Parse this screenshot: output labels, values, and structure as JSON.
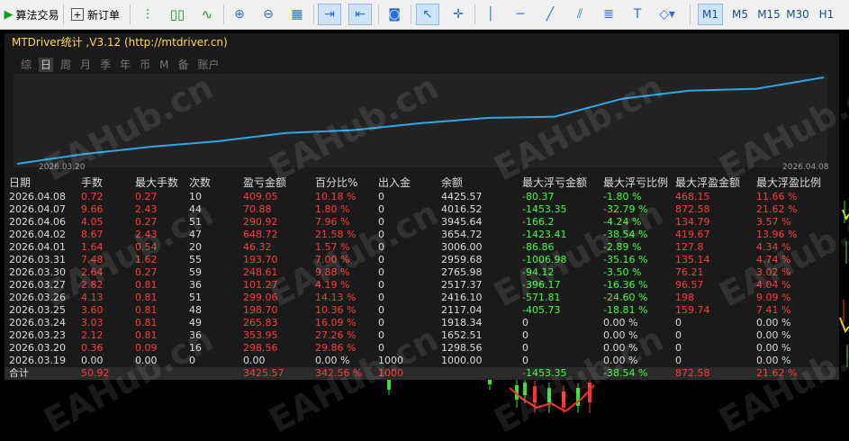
{
  "toolbar": {
    "algo_trading_label": "算法交易",
    "new_order_label": "新订单",
    "timeframes": [
      "M1",
      "M5",
      "M15",
      "M30",
      "H1"
    ],
    "active_timeframe": "M1"
  },
  "panel": {
    "title": "MTDriver统计 ,V3.12 (http://mtdriver.cn)",
    "tabs": [
      "综",
      "日",
      "周",
      "月",
      "季",
      "年",
      "币",
      "M",
      "备",
      "账户"
    ],
    "active_tab": "日",
    "start_date": "2026.03.20",
    "end_date": "2026.04.08"
  },
  "equity_curve": {
    "line_color": "#29a9e8",
    "dates": [
      "2026.03.20",
      "2026.03.23",
      "2026.03.24",
      "2026.03.25",
      "2026.03.26",
      "2026.03.27",
      "2026.03.30",
      "2026.03.31",
      "2026.04.01",
      "2026.04.02",
      "2026.04.06",
      "2026.04.07",
      "2026.04.08"
    ],
    "balance": [
      1298.56,
      1652.51,
      1918.34,
      2117.04,
      2416.1,
      2517.37,
      2765.98,
      2959.68,
      3006.0,
      3654.72,
      3945.64,
      4016.52,
      4425.57
    ]
  },
  "table": {
    "headers": [
      "日期",
      "手数",
      "最大手数",
      "次数",
      "盈亏金额",
      "百分比%",
      "出入金",
      "余额",
      "最大浮亏金额",
      "最大浮亏比例",
      "最大浮盈金额",
      "最大浮盈比例"
    ],
    "rows": [
      [
        "2026.04.08",
        "0.72",
        "0.27",
        "10",
        "409.05",
        "10.18 %",
        "0",
        "4425.57",
        "-80.37",
        "-1.80 %",
        "468.15",
        "11.66 %"
      ],
      [
        "2026.04.07",
        "9.66",
        "2.43",
        "44",
        "70.88",
        "1.80 %",
        "0",
        "4016.52",
        "-1453.35",
        "-32.79 %",
        "872.58",
        "21.62 %"
      ],
      [
        "2026.04.06",
        "4.05",
        "0.27",
        "51",
        "290.92",
        "7.96 %",
        "0",
        "3945.64",
        "-166.2",
        "-4.24 %",
        "134.79",
        "3.57 %"
      ],
      [
        "2026.04.02",
        "8.67",
        "2.43",
        "47",
        "648.72",
        "21.58 %",
        "0",
        "3654.72",
        "-1423.41",
        "-38.54 %",
        "419.67",
        "13.96 %"
      ],
      [
        "2026.04.01",
        "1.64",
        "0.54",
        "20",
        "46.32",
        "1.57 %",
        "0",
        "3006.00",
        "-86.86",
        "-2.89 %",
        "127.8",
        "4.34 %"
      ],
      [
        "2026.03.31",
        "7.48",
        "1.62",
        "55",
        "193.70",
        "7.00 %",
        "0",
        "2959.68",
        "-1006.98",
        "-35.16 %",
        "135.14",
        "4.74 %"
      ],
      [
        "2026.03.30",
        "2.64",
        "0.27",
        "59",
        "248.61",
        "9.88 %",
        "0",
        "2765.98",
        "-94.12",
        "-3.50 %",
        "76.21",
        "3.02 %"
      ],
      [
        "2026.03.27",
        "2.82",
        "0.81",
        "36",
        "101.27",
        "4.19 %",
        "0",
        "2517.37",
        "-396.17",
        "-16.36 %",
        "96.57",
        "4.04 %"
      ],
      [
        "2026.03.26",
        "4.13",
        "0.81",
        "51",
        "299.06",
        "14.13 %",
        "0",
        "2416.10",
        "-571.81",
        "-24.60 %",
        "198",
        "9.09 %"
      ],
      [
        "2026.03.25",
        "3.60",
        "0.81",
        "48",
        "198.70",
        "10.36 %",
        "0",
        "2117.04",
        "-405.73",
        "-18.81 %",
        "159.74",
        "7.41 %"
      ],
      [
        "2026.03.24",
        "3.03",
        "0.81",
        "49",
        "265.83",
        "16.09 %",
        "0",
        "1918.34",
        "0",
        "0.00 %",
        "0",
        "0.00 %"
      ],
      [
        "2026.03.23",
        "2.12",
        "0.81",
        "36",
        "353.95",
        "27.26 %",
        "0",
        "1652.51",
        "0",
        "0.00 %",
        "0",
        "0.00 %"
      ],
      [
        "2026.03.20",
        "0.36",
        "0.09",
        "16",
        "298.56",
        "29.86 %",
        "0",
        "1298.56",
        "0",
        "0.00 %",
        "0",
        "0.00 %"
      ],
      [
        "2026.03.19",
        "0.00",
        "0.00",
        "0",
        "0.00",
        "0.00 %",
        "1000",
        "1000.00",
        "0",
        "0.00 %",
        "0",
        "0.00 %"
      ]
    ],
    "total": [
      "合计",
      "50.92",
      "",
      "",
      "3425.57",
      "342.56 %",
      "1000",
      "",
      "-1453.35",
      "-38.54 %",
      "872.58",
      "21.62 %"
    ]
  },
  "watermark": "EAHub.cn"
}
